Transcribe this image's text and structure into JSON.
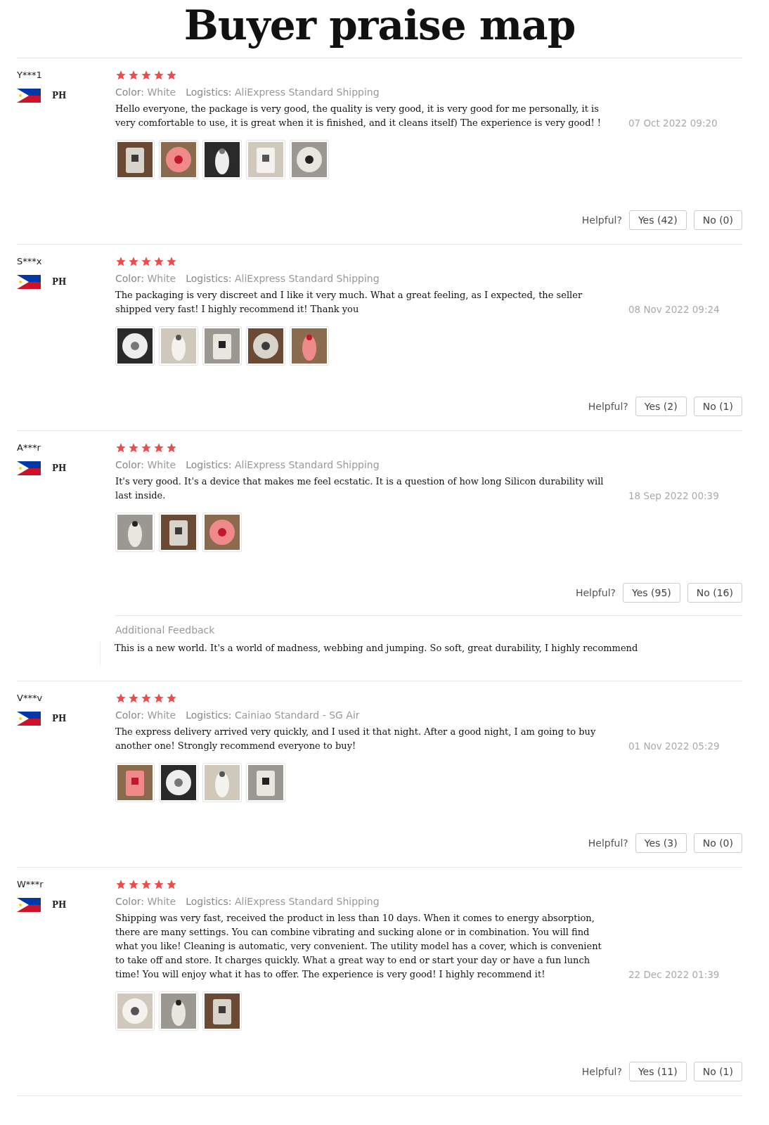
{
  "title": "Buyer praise map",
  "reviews": [
    {
      "name": "Y***1",
      "country": "PH",
      "stars": 5,
      "color_label": "Color:",
      "variant": "White",
      "logistics_label": "Logistics:",
      "logistics": "AliExpress Standard Shipping",
      "text": "Hello everyone, the package is very good, the quality is very good, it is very good for me personally, it is very comfortable to use, it is great when it is finished, and it cleans itself) The experience is very good! !",
      "date": "07 Oct 2022 09:20",
      "photos": [
        {
          "kind": "picture"
        },
        {
          "kind": "picture"
        },
        {
          "kind": "picture"
        },
        {
          "kind": "picture"
        },
        {
          "kind": "picture"
        }
      ],
      "helpful_label": "Helpful?",
      "yes": "Yes (42)",
      "no": "No (0)"
    },
    {
      "name": "S***x",
      "country": "PH",
      "stars": 5,
      "color_label": "Color:",
      "variant": "White",
      "logistics_label": "Logistics:",
      "logistics": "AliExpress Standard Shipping",
      "text": "The packaging is very discreet and I like it very much. What a great feeling, as I expected, the seller shipped very fast! I highly recommend it! Thank you",
      "date": "08 Nov 2022 09:24",
      "photos": [
        {
          "kind": "picture"
        },
        {
          "kind": "picture"
        },
        {
          "kind": "picture"
        },
        {
          "kind": "picture"
        },
        {
          "kind": "picture"
        }
      ],
      "helpful_label": "Helpful?",
      "yes": "Yes (2)",
      "no": "No (1)"
    },
    {
      "name": "A***r",
      "country": "PH",
      "stars": 5,
      "color_label": "Color:",
      "variant": "White",
      "logistics_label": "Logistics:",
      "logistics": "AliExpress Standard Shipping",
      "text": "It's very good. It's a device that makes me feel ecstatic. It is a question of how long Silicon durability will last inside.",
      "date": "18 Sep 2022 00:39",
      "photos": [
        {
          "kind": "picture"
        },
        {
          "kind": "picture"
        },
        {
          "kind": "picture"
        }
      ],
      "helpful_label": "Helpful?",
      "yes": "Yes (95)",
      "no": "No (16)",
      "additional_feedback": {
        "label": "Additional Feedback",
        "text": "This is a new world. It's a world of madness, webbing and jumping. So soft, great durability, I highly recommend"
      }
    },
    {
      "name": "V***v",
      "country": "PH",
      "stars": 5,
      "color_label": "Color:",
      "variant": "White",
      "logistics_label": "Logistics:",
      "logistics": "Cainiao Standard - SG Air",
      "text": "The express delivery arrived very quickly, and I used it that night. After a good night, I am going to buy another one! Strongly recommend everyone to buy!",
      "date": "01 Nov 2022 05:29",
      "photos": [
        {
          "kind": "picture"
        },
        {
          "kind": "picture"
        },
        {
          "kind": "picture"
        },
        {
          "kind": "picture"
        }
      ],
      "helpful_label": "Helpful?",
      "yes": "Yes (3)",
      "no": "No (0)"
    },
    {
      "name": "W***r",
      "country": "PH",
      "stars": 5,
      "color_label": "Color:",
      "variant": "White",
      "logistics_label": "Logistics:",
      "logistics": "AliExpress Standard Shipping",
      "text": "Shipping was very fast, received the product in less than 10 days. When it comes to energy absorption, there are many settings. You can combine vibrating and sucking alone or in combination. You will find what you like! Cleaning is automatic, very convenient. The utility model has a cover, which is convenient to take off and store. It charges quickly. What a great way to end or start your day or have a fun lunch time! You will enjoy what it has to offer. The experience is very good! I highly recommend it!",
      "date": "22 Dec 2022 01:39",
      "photos": [
        {
          "kind": "picture"
        },
        {
          "kind": "picture"
        },
        {
          "kind": "picture"
        }
      ],
      "helpful_label": "Helpful?",
      "yes": "Yes (11)",
      "no": "No (1)"
    }
  ]
}
